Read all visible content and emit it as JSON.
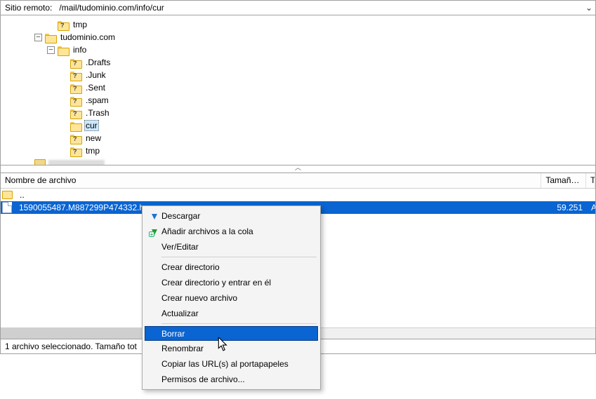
{
  "address": {
    "label": "Sitio remoto:",
    "path": "/mail/tudominio.com/info/cur"
  },
  "tree": {
    "nodes": [
      {
        "indent": 1,
        "toggle": "",
        "folder_q": true,
        "label": "tmp",
        "selected": false
      },
      {
        "indent": 0,
        "toggle": "−",
        "folder_q": false,
        "label": "tudominio.com",
        "selected": false
      },
      {
        "indent": 1,
        "toggle": "−",
        "folder_q": false,
        "label": "info",
        "selected": false
      },
      {
        "indent": 2,
        "toggle": "",
        "folder_q": true,
        "label": ".Drafts",
        "selected": false
      },
      {
        "indent": 2,
        "toggle": "",
        "folder_q": true,
        "label": ".Junk",
        "selected": false
      },
      {
        "indent": 2,
        "toggle": "",
        "folder_q": true,
        "label": ".Sent",
        "selected": false
      },
      {
        "indent": 2,
        "toggle": "",
        "folder_q": true,
        "label": ".spam",
        "selected": false
      },
      {
        "indent": 2,
        "toggle": "",
        "folder_q": true,
        "label": ".Trash",
        "selected": false
      },
      {
        "indent": 2,
        "toggle": "",
        "folder_q": false,
        "label": "cur",
        "selected": true
      },
      {
        "indent": 2,
        "toggle": "",
        "folder_q": true,
        "label": "new",
        "selected": false
      },
      {
        "indent": 2,
        "toggle": "",
        "folder_q": true,
        "label": "tmp",
        "selected": false
      }
    ]
  },
  "list": {
    "columns": {
      "name": "Nombre de archivo",
      "size": "Tamaño d...",
      "type": "Tipo de arc."
    },
    "parent_dir": "..",
    "rows": [
      {
        "name": "1590055487.M887299P474332.h",
        "size": "59.251",
        "type": "Archivo O..."
      }
    ]
  },
  "status": {
    "text": "1 archivo seleccionado. Tamaño tot"
  },
  "menu": {
    "download": "Descargar",
    "add_queue": "Añadir archivos a la cola",
    "view_edit": "Ver/Editar",
    "mkdir": "Crear directorio",
    "mkdir_enter": "Crear directorio y entrar en él",
    "newfile": "Crear nuevo archivo",
    "refresh": "Actualizar",
    "delete": "Borrar",
    "rename": "Renombrar",
    "copy_url": "Copiar las URL(s) al portapapeles",
    "perms": "Permisos de archivo..."
  }
}
